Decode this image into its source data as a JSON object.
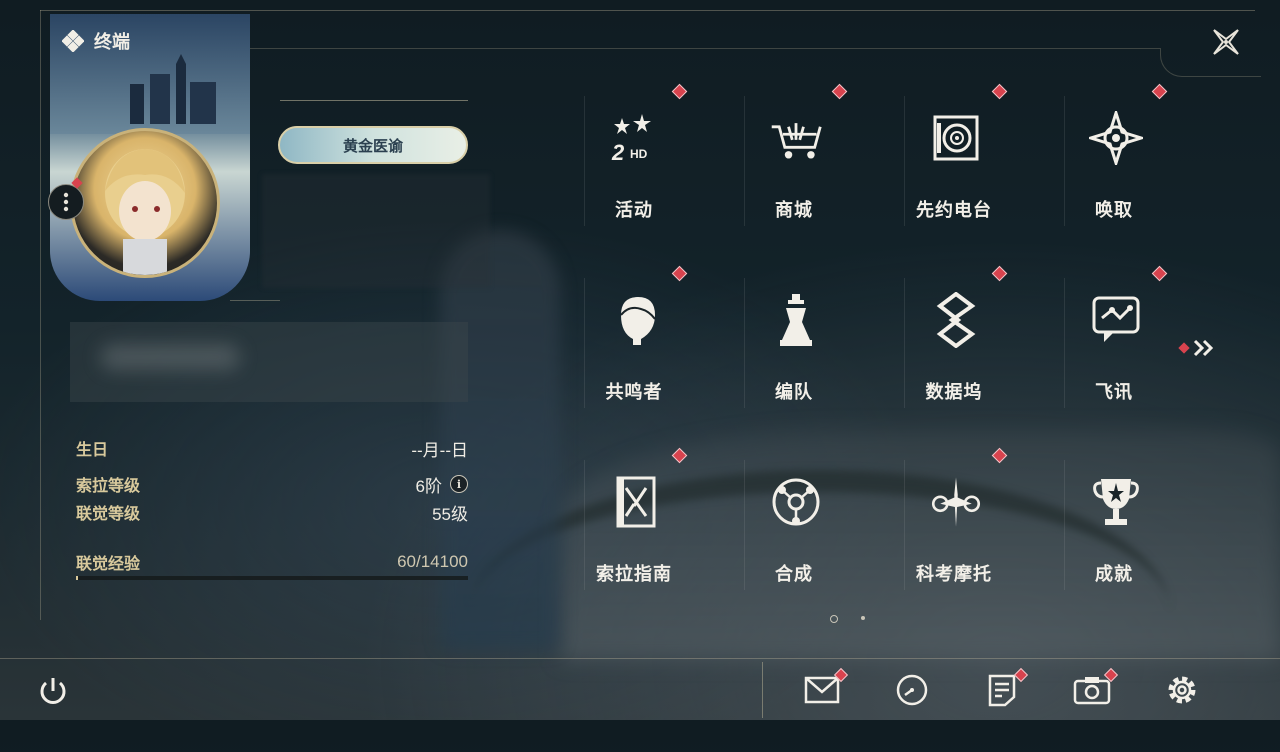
{
  "header": {
    "title": "终端"
  },
  "profile": {
    "badge": "黄金医谕",
    "stats": [
      {
        "label": "生日",
        "value": "--月--日"
      },
      {
        "label": "索拉等级",
        "value": "6阶"
      },
      {
        "label": "联觉等级",
        "value": "55级"
      },
      {
        "label": "联觉经验",
        "value": "60/14100"
      }
    ],
    "xp_fraction": 0.004
  },
  "menu": {
    "items": [
      {
        "label": "活动",
        "icon": "events-2hd-icon",
        "notify": true
      },
      {
        "label": "商城",
        "icon": "shop-cart-icon",
        "notify": true
      },
      {
        "label": "先约电台",
        "icon": "radio-icon",
        "notify": true
      },
      {
        "label": "唤取",
        "icon": "gacha-star-icon",
        "notify": true
      },
      {
        "label": "共鸣者",
        "icon": "resonator-head-icon",
        "notify": true
      },
      {
        "label": "编队",
        "icon": "team-chess-icon",
        "notify": false
      },
      {
        "label": "数据坞",
        "icon": "data-bank-icon",
        "notify": true
      },
      {
        "label": "飞讯",
        "icon": "message-chat-icon",
        "notify": true
      },
      {
        "label": "索拉指南",
        "icon": "guide-book-icon",
        "notify": true
      },
      {
        "label": "合成",
        "icon": "synthesis-icon",
        "notify": false
      },
      {
        "label": "科考摩托",
        "icon": "motorcycle-icon",
        "notify": true
      },
      {
        "label": "成就",
        "icon": "trophy-icon",
        "notify": false
      }
    ],
    "page": {
      "current": 1,
      "total": 2
    }
  },
  "bottom_bar": {
    "icons": [
      {
        "name": "mail-icon",
        "notify": true
      },
      {
        "name": "clock-icon",
        "notify": false
      },
      {
        "name": "notes-icon",
        "notify": true
      },
      {
        "name": "camera-icon",
        "notify": true
      },
      {
        "name": "settings-gear-icon",
        "notify": false
      }
    ]
  },
  "colors": {
    "accent_gold": "#d8c99c",
    "notify_red": "#d8434e",
    "text": "#f2efe8"
  }
}
